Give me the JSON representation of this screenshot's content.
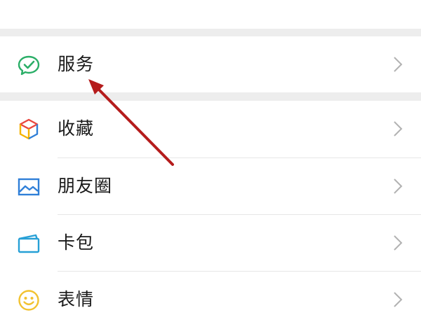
{
  "menu": {
    "items": [
      {
        "label": "服务",
        "icon": "service-check-icon"
      },
      {
        "label": "收藏",
        "icon": "favorites-cube-icon"
      },
      {
        "label": "朋友圈",
        "icon": "moments-picture-icon"
      },
      {
        "label": "卡包",
        "icon": "card-wallet-icon"
      },
      {
        "label": "表情",
        "icon": "smiley-face-icon"
      }
    ]
  },
  "colors": {
    "section_gap": "#ededed",
    "divider": "#e6e6e6",
    "chevron": "#b2b2b2",
    "annotation_arrow": "#b51c1c",
    "service_icon": "#2aae67",
    "moments_icon": "#2f7fd8",
    "wallet_icon": "#27a0d6",
    "smiley_icon": "#f2c230"
  }
}
